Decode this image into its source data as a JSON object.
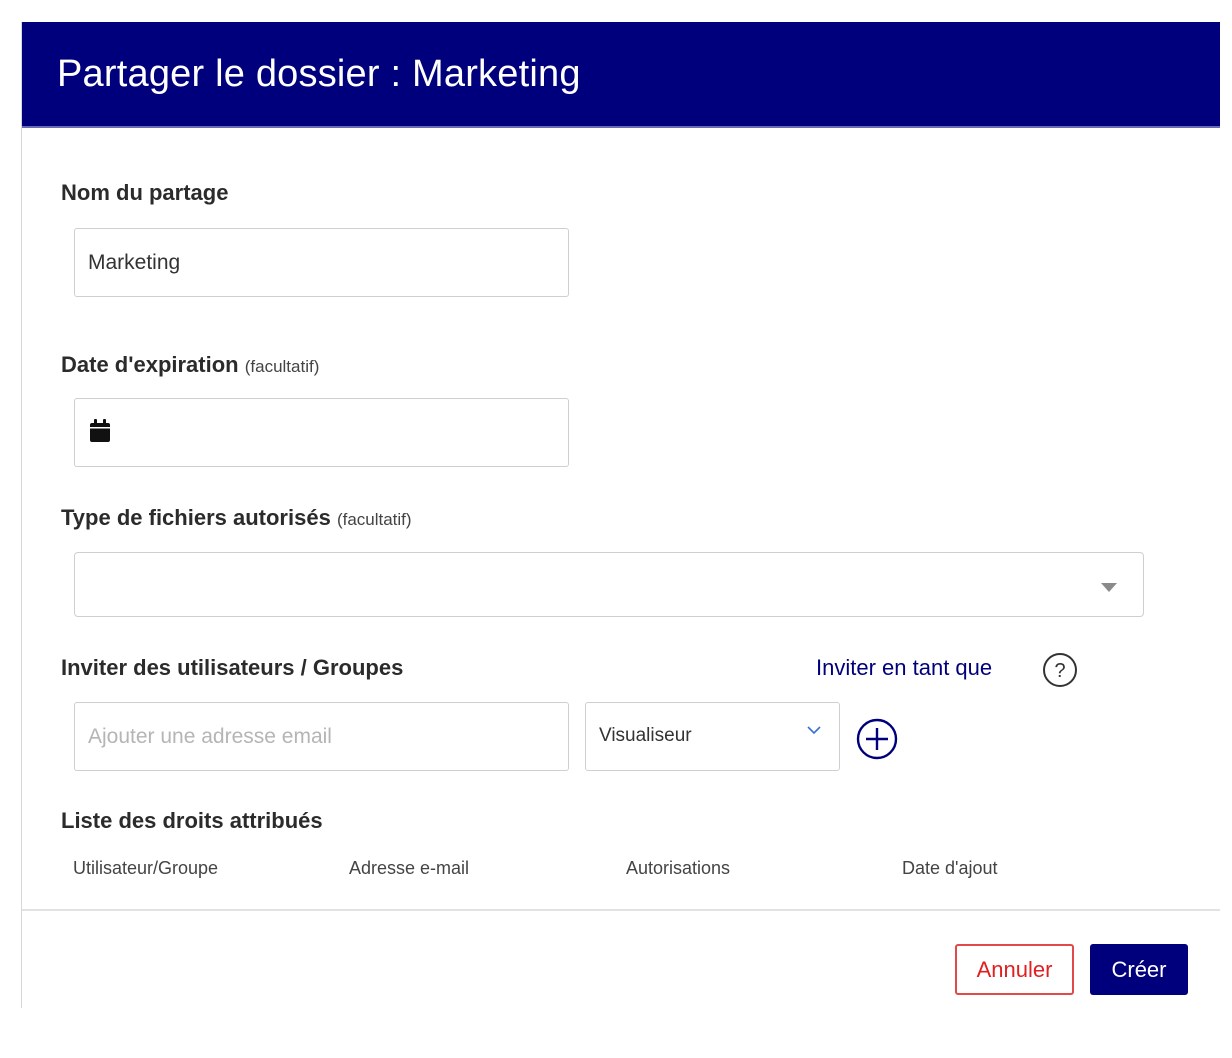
{
  "dialog": {
    "title": "Partager le dossier : Marketing"
  },
  "share_name": {
    "label": "Nom du partage",
    "value": "Marketing"
  },
  "expiration": {
    "label": "Date d'expiration",
    "optional": "(facultatif)",
    "value": "",
    "icon": "calendar-icon"
  },
  "file_types": {
    "label": "Type de fichiers autorisés",
    "optional": "(facultatif)",
    "value": ""
  },
  "invite": {
    "label": "Inviter des utilisateurs / Groupes",
    "invite_as_label": "Inviter en tant que",
    "email_placeholder": "Ajouter une adresse email",
    "email_value": "",
    "role_selected": "Visualiseur"
  },
  "rights": {
    "label": "Liste des droits attribués",
    "columns": [
      "Utilisateur/Groupe",
      "Adresse e-mail",
      "Autorisations",
      "Date d'ajout"
    ]
  },
  "footer": {
    "cancel_label": "Annuler",
    "create_label": "Créer"
  },
  "colors": {
    "header_bg": "#00007c",
    "accent": "#00007c",
    "cancel": "#e02020"
  }
}
